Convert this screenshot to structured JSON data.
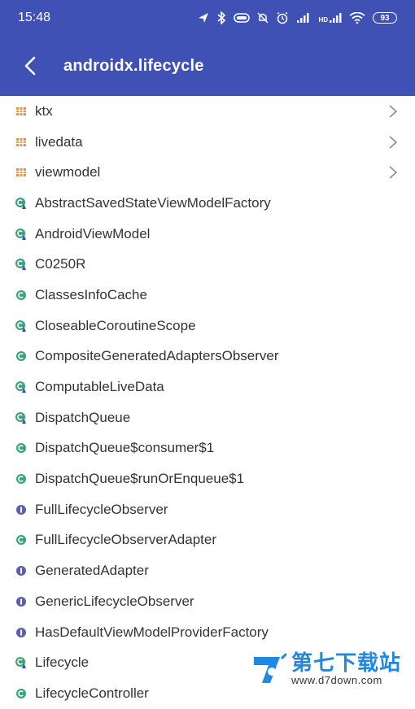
{
  "status_bar": {
    "time": "15:48",
    "icons": [
      "location-icon",
      "bluetooth-icon",
      "data-saver-icon",
      "mute-icon",
      "alarm-icon",
      "signal-icon",
      "signal-hd-icon",
      "wifi-icon"
    ],
    "hd_label": "HD",
    "battery": "93"
  },
  "app_bar": {
    "title": "androidx.lifecycle",
    "color": "#3f51b5"
  },
  "list": {
    "items": [
      {
        "name": "ktx",
        "kind": "package",
        "chevron": true
      },
      {
        "name": "livedata",
        "kind": "package",
        "chevron": true
      },
      {
        "name": "viewmodel",
        "kind": "package",
        "chevron": true
      },
      {
        "name": "AbstractSavedStateViewModelFactory",
        "kind": "class-abstract"
      },
      {
        "name": "AndroidViewModel",
        "kind": "class-abstract"
      },
      {
        "name": "C0250R",
        "kind": "class-abstract"
      },
      {
        "name": "ClassesInfoCache",
        "kind": "class"
      },
      {
        "name": "CloseableCoroutineScope",
        "kind": "class-abstract"
      },
      {
        "name": "CompositeGeneratedAdaptersObserver",
        "kind": "class"
      },
      {
        "name": "ComputableLiveData",
        "kind": "class-abstract"
      },
      {
        "name": "DispatchQueue",
        "kind": "class-abstract"
      },
      {
        "name": "DispatchQueue$consumer$1",
        "kind": "class"
      },
      {
        "name": "DispatchQueue$runOrEnqueue$1",
        "kind": "class"
      },
      {
        "name": "FullLifecycleObserver",
        "kind": "interface"
      },
      {
        "name": "FullLifecycleObserverAdapter",
        "kind": "class"
      },
      {
        "name": "GeneratedAdapter",
        "kind": "interface"
      },
      {
        "name": "GenericLifecycleObserver",
        "kind": "interface"
      },
      {
        "name": "HasDefaultViewModelProviderFactory",
        "kind": "interface"
      },
      {
        "name": "Lifecycle",
        "kind": "class-abstract"
      },
      {
        "name": "LifecycleController",
        "kind": "class"
      }
    ]
  },
  "watermark": {
    "cn": "第七下载站",
    "url": "www.d7down.com"
  }
}
